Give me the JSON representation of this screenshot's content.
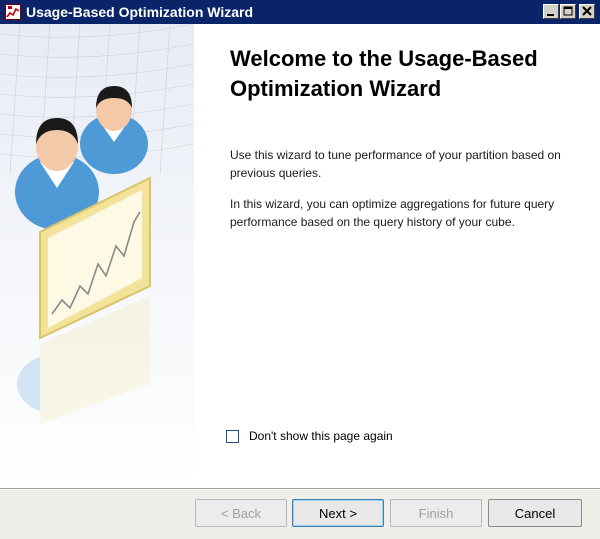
{
  "window": {
    "title": "Usage-Based Optimization Wizard"
  },
  "content": {
    "heading": "Welcome to the Usage-Based Optimization Wizard",
    "paragraph1": "Use this wizard to tune performance of your partition based on previous queries.",
    "paragraph2": "In this wizard, you can optimize aggregations for future query performance based on the query history of your cube.",
    "dont_show_label": "Don't show this page again",
    "dont_show_checked": false
  },
  "buttons": {
    "back": "< Back",
    "next": "Next >",
    "finish": "Finish",
    "cancel": "Cancel"
  },
  "colors": {
    "titlebar": "#0a246a",
    "banner_person_shirt": "#4d9ad6",
    "chart_frame": "#f2e29a"
  }
}
